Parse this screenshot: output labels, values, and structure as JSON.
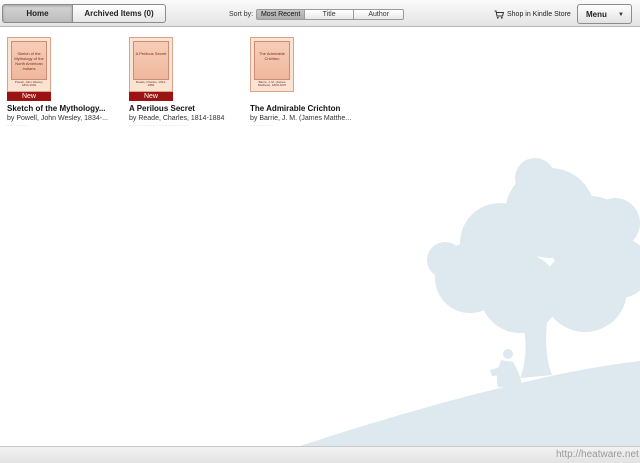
{
  "toolbar": {
    "tabs": [
      {
        "label": "Home",
        "active": true
      },
      {
        "label": "Archived Items (0)",
        "active": false
      }
    ],
    "sort_label": "Sort by:",
    "sort_options": [
      {
        "label": "Most Recent",
        "active": true
      },
      {
        "label": "Title",
        "active": false
      },
      {
        "label": "Author",
        "active": false
      }
    ],
    "shop_label": "Shop in Kindle Store",
    "shop_icon": "cart-icon",
    "menu_label": "Menu",
    "menu_icon": "chevron-down-icon"
  },
  "books": [
    {
      "title": "Sketch of the Mythology...",
      "author": "by Powell, John Wesley, 1834-...",
      "badge": "New",
      "cover_title": "Sketch of the Mythology of the North American Indians",
      "cover_author": "Powell, John Wesley, 1834-1902",
      "dots": "·······"
    },
    {
      "title": "A Perilous Secret",
      "author": "by Reade, Charles, 1814-1884",
      "badge": "New",
      "cover_title": "A Perilous Secret",
      "cover_author": "Reade, Charles, 1814-1884",
      "dots": "····················"
    },
    {
      "title": "The Admirable Crichton",
      "author": "by Barrie, J. M. (James Matthe...",
      "badge": "",
      "cover_title": "The Admirable Crichton",
      "cover_author": "Barrie, J. M. (James Matthew), 1860-1937",
      "dots": "········"
    }
  ],
  "watermark": "http://heatware.net",
  "colors": {
    "badge_red": "#9b1313",
    "tree": "#dde9ef"
  }
}
